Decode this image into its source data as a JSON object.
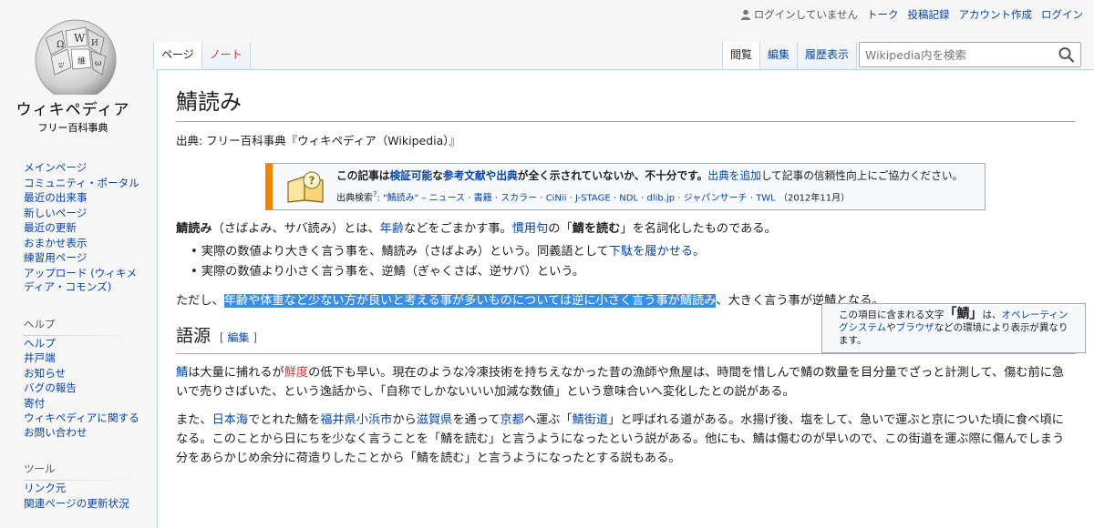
{
  "logo": {
    "wordmark": "ウィキペディア",
    "tagline": "フリー百科事典"
  },
  "personal": {
    "anon": "ログインしていません",
    "talk": "トーク",
    "contribs": "投稿記録",
    "create": "アカウント作成",
    "login": "ログイン"
  },
  "tabs": {
    "page": "ページ",
    "note": "ノート",
    "read": "閲覧",
    "edit": "編集",
    "history": "履歴表示"
  },
  "search": {
    "placeholder": "Wikipedia内を検索"
  },
  "sidebar": {
    "nav": [
      "メインページ",
      "コミュニティ・ポータル",
      "最近の出来事",
      "新しいページ",
      "最近の更新",
      "おまかせ表示",
      "練習用ページ",
      "アップロード (ウィキメディア・コモンズ)"
    ],
    "help_head": "ヘルプ",
    "help": [
      "ヘルプ",
      "井戸端",
      "お知らせ",
      "バグの報告",
      "寄付",
      "ウィキペディアに関するお問い合わせ"
    ],
    "tools_head": "ツール",
    "tools": [
      "リンク元",
      "関連ページの更新状況"
    ]
  },
  "article": {
    "title": "鯖読み",
    "sitesub": "出典: フリー百科事典『ウィキペディア（Wikipedia）』",
    "ambox": {
      "l1a": "この記事は",
      "l1b": "検証可能",
      "l1c": "な",
      "l1d": "参考文献や出典",
      "l1e": "が全く示されていないか、不十分です。",
      "l1f": "出典を追加",
      "l1g": "して記事の信頼性向上にご協力ください。",
      "src_label": "出典検索",
      "src_sup": "?",
      "src_q": "\"鯖読み\"",
      "src_links": [
        "ニュース",
        "書籍",
        "スカラー",
        "CiNii",
        "J-STAGE",
        "NDL",
        "dlib.jp",
        "ジャパンサーチ",
        "TWL"
      ],
      "src_date": "（2012年11月）"
    },
    "infobox": {
      "a": "この項目に含まれる文字",
      "char": "「鯖」",
      "b": "は、",
      "os": "オペレーティングシステム",
      "c": "や",
      "browser": "ブラウザ",
      "d": "などの環境により表示が異なります。"
    },
    "p1": {
      "bold": "鯖読み",
      "a": "（さばよみ、サバ読み）とは、",
      "l1": "年齢",
      "b": "などをごまかす事。",
      "l2": "慣用句",
      "c": "の「",
      "bold2": "鯖を読む",
      "d": "」を名詞化したものである。"
    },
    "bullets": {
      "b1a": "実際の数値より大きく言う事を、鯖読み（さばよみ）という。同義語として",
      "b1l": "下駄を履かせる",
      "b1b": "。",
      "b2": "実際の数値より小さく言う事を、逆鯖（ぎゃくさば、逆サバ）という。"
    },
    "p2": {
      "a": "ただし、",
      "hl": "年齢や体重など少ない方が良いと考える事が多いものについては逆に小さく言う事が鯖読み",
      "b": "、大きく言う事が逆鯖となる。"
    },
    "h2": {
      "title": "語源",
      "lb": "[ ",
      "edit": "編集",
      "rb": " ]"
    },
    "p3": {
      "l1": "鯖",
      "a": "は大量に捕れるが",
      "red": "鮮度",
      "b": "の低下も早い。現在のような冷凍技術を持ちえなかった昔の漁師や魚屋は、時間を惜しんで鯖の数量を目分量でざっと計測して、傷む前に急いで売りさばいた、という逸話から、「自称でしかないいい加減な数値」という意味合いへ変化したとの説がある。"
    },
    "p4": {
      "a": "また、",
      "l1": "日本海",
      "b": "でとれた鯖を",
      "l2": "福井県",
      "l3": "小浜市",
      "c": "から",
      "l4": "滋賀県",
      "d": "を通って",
      "l5": "京都",
      "e": "へ運ぶ「",
      "l6": "鯖街道",
      "f": "」と呼ばれる道がある。水揚げ後、塩をして、急いで運ぶと京についた頃に食べ頃になる。このことから日にちを少なく言うことを「鯖を読む」と言うようになったという説がある。他にも、鯖は傷むのが早いので、この街道を運ぶ際に傷んでしまう分をあらかじめ余分に荷造りしたことから「鯖を読む」と言うようになったとする説もある。"
    }
  }
}
